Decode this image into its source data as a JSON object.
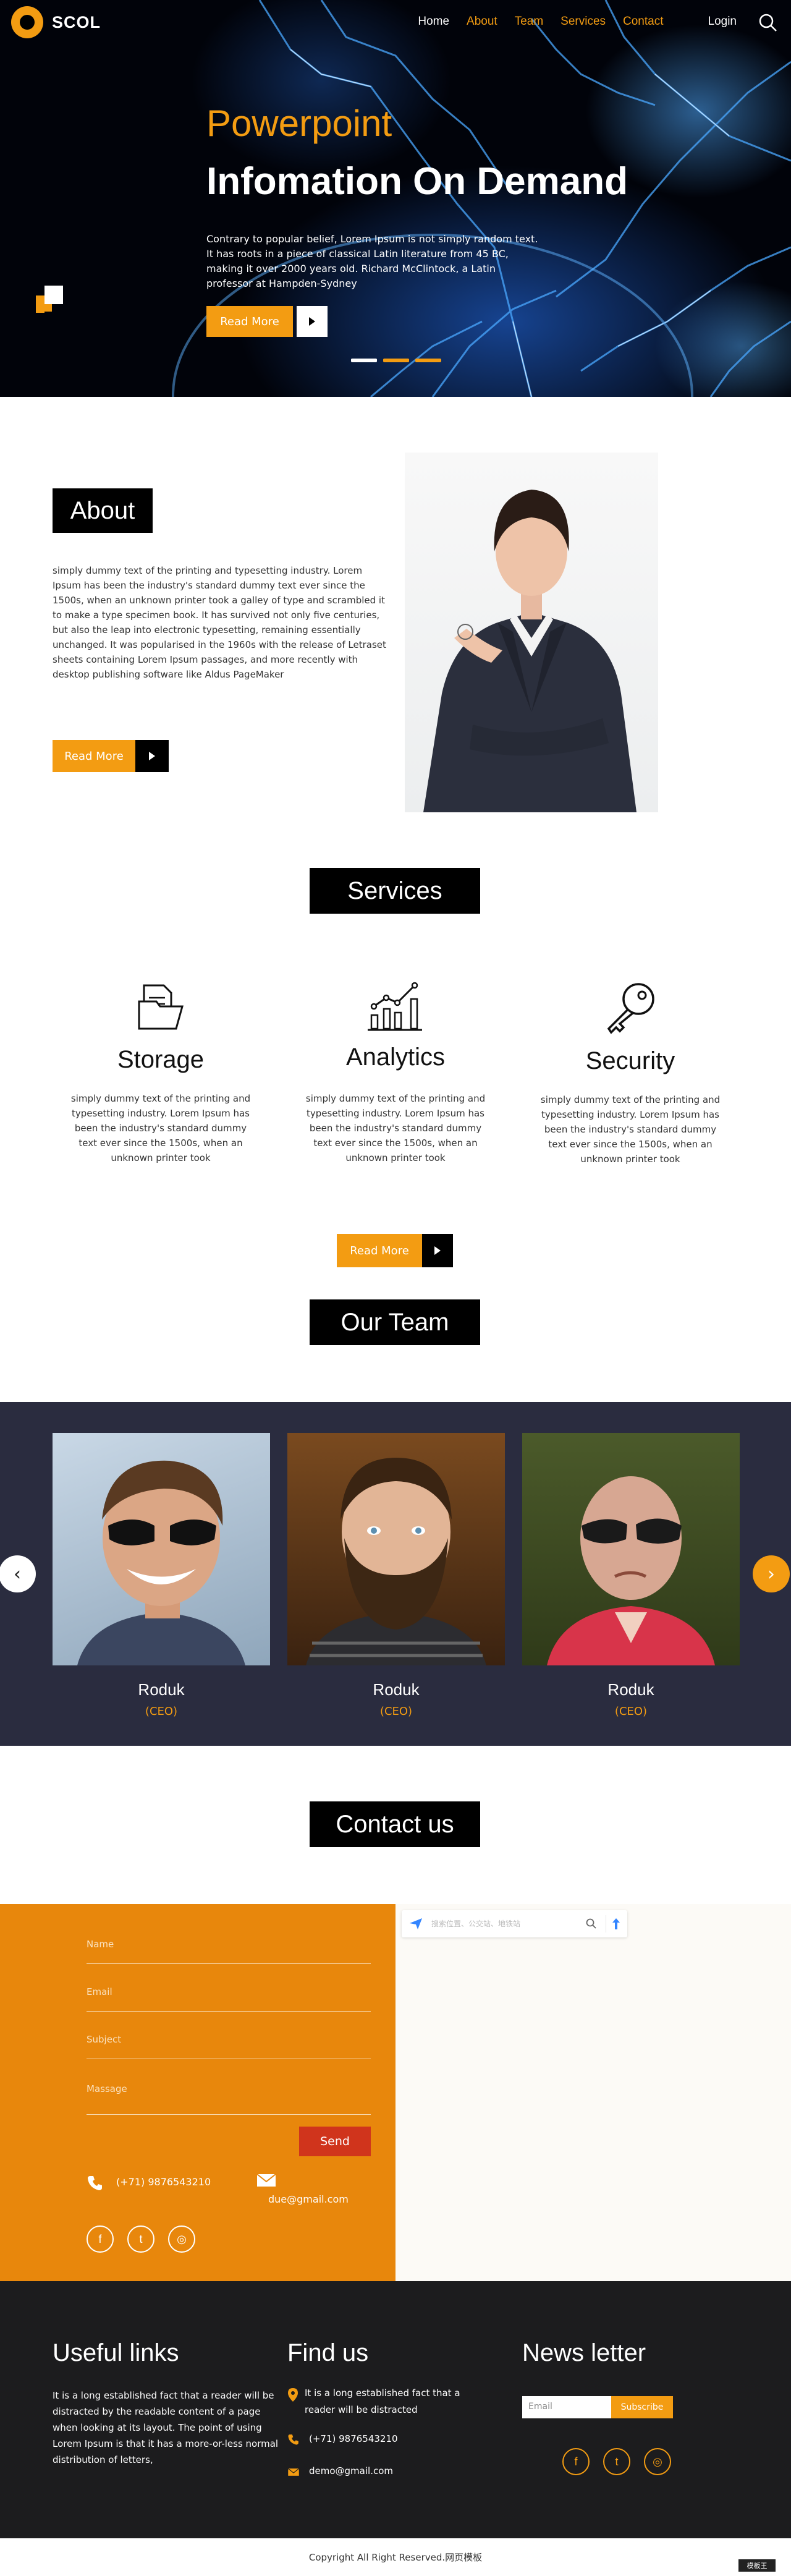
{
  "brand": {
    "name": "SCOL",
    "accent": "#f39c12"
  },
  "nav": {
    "home": "Home",
    "about": "About",
    "team": "Team",
    "services": "Services",
    "contact": "Contact",
    "login": "Login"
  },
  "hero": {
    "subtitle": "Powerpoint",
    "title": "Infomation On Demand",
    "text": "Contrary to popular belief, Lorem Ipsum is not simply random text. It has roots in a piece of classical Latin literature from 45 BC, making it over 2000 years old. Richard McClintock, a Latin professor at Hampden-Sydney",
    "button": "Read More"
  },
  "about": {
    "title": "About",
    "text": "simply dummy text of the printing and typesetting industry. Lorem Ipsum has been the industry's standard dummy text ever since the 1500s, when an unknown printer took a galley of type and scrambled it to make a type specimen book. It has survived not only five centuries, but also the leap into electronic typesetting, remaining essentially unchanged. It was popularised in the 1960s with the release of Letraset sheets containing Lorem Ipsum passages, and more recently with desktop publishing software like Aldus PageMaker",
    "button": "Read More"
  },
  "services": {
    "title": "Services",
    "items": [
      {
        "title": "Storage",
        "icon": "folder-icon",
        "text": "simply dummy text of the printing and typesetting industry. Lorem Ipsum has been the industry's standard dummy text ever since the 1500s, when an unknown printer took"
      },
      {
        "title": "Analytics",
        "icon": "chart-icon",
        "text": "simply dummy text of the printing and typesetting industry. Lorem Ipsum has been the industry's standard dummy text ever since the 1500s, when an unknown printer took"
      },
      {
        "title": "Security",
        "icon": "key-icon",
        "text": "simply dummy text of the printing and typesetting industry. Lorem Ipsum has been the industry's standard dummy text ever since the 1500s, when an unknown printer took"
      }
    ],
    "button": "Read More"
  },
  "team": {
    "title": "Our Team",
    "members": [
      {
        "name": "Roduk",
        "role": "(CEO)"
      },
      {
        "name": "Roduk",
        "role": "(CEO)"
      },
      {
        "name": "Roduk",
        "role": "(CEO)"
      }
    ],
    "prev": "‹",
    "next": "›"
  },
  "contact": {
    "title": "Contact us",
    "name_label": "Name",
    "email_label": "Email",
    "subject_label": "Subject",
    "message_label": "Massage",
    "send": "Send",
    "phone": "(+71) 9876543210",
    "email": "due@gmail.com",
    "map_search_placeholder": "搜索位置、公交站、地铁站"
  },
  "footer": {
    "useful_title": "Useful links",
    "useful_text": "It is a long established fact that a reader will be distracted by the readable content of a page when looking at its layout. The point of using Lorem Ipsum is that it has a more-or-less normal distribution of letters,",
    "find_title": "Find us",
    "find_address": "It is a long established fact that a reader will be distracted",
    "find_phone": "(+71) 9876543210",
    "find_email": "demo@gmail.com",
    "news_title": "News letter",
    "news_placeholder": "Email",
    "subscribe": "Subscribe",
    "copyright": "Copyright All Right Reserved.网页模板",
    "badge": "模板王"
  },
  "social": {
    "facebook": "f",
    "twitter": "t",
    "instagram": "◎"
  }
}
